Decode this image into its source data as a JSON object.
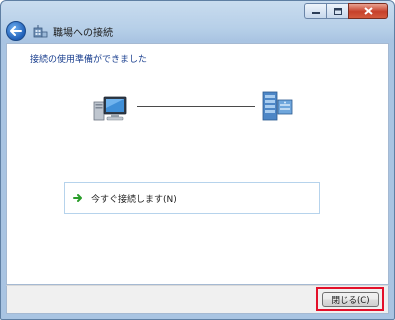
{
  "window": {
    "title": "職場への接続",
    "caption_buttons": [
      "minimize",
      "maximize",
      "close"
    ]
  },
  "content": {
    "heading": "接続の使用準備ができました",
    "task_link_label": "今すぐ接続します(N)"
  },
  "footer": {
    "close_label": "閉じる(C)"
  },
  "colors": {
    "heading": "#1a3f8f",
    "highlight": "#e3102a",
    "arrow": "#2a9d2a"
  }
}
